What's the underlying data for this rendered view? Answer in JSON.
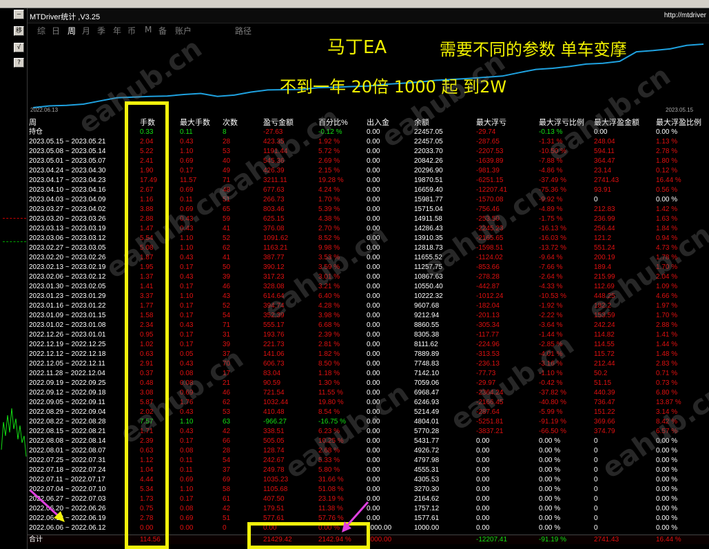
{
  "left_buttons": [
    "—",
    "移",
    "√",
    "?"
  ],
  "window": {
    "title": "MTDriver统计 ,V3.25",
    "url": "http://mtdriver"
  },
  "tabs": [
    {
      "label": "综",
      "active": false
    },
    {
      "label": "日",
      "active": false
    },
    {
      "label": "周",
      "active": true
    },
    {
      "label": "月",
      "active": false
    },
    {
      "label": "季",
      "active": false
    },
    {
      "label": "年",
      "active": false
    },
    {
      "label": "币",
      "active": false
    },
    {
      "label": "M",
      "active": false
    },
    {
      "label": "备",
      "active": false
    },
    {
      "label": "账户",
      "active": false
    },
    {
      "label": "路径",
      "active": false
    }
  ],
  "overlays": {
    "line1": "马丁EA",
    "line2": "需要不同的参数  单车变摩",
    "line3": "不到一年  20倍 1000 起 到2W"
  },
  "chart_data": {
    "type": "line",
    "x_start": "2022.06.13",
    "x_end": "2023.05.15",
    "line_color": "#1fa2e0"
  },
  "watermark": "eahub.cn",
  "headers": [
    "周",
    "手数",
    "最大手数",
    "次数",
    "盈亏金额",
    "百分比%",
    "出入金",
    "余额",
    "最大浮亏",
    "最大浮亏比例",
    "最大浮盈金额",
    "最大浮盈比例"
  ],
  "position_row": [
    "持仓",
    "0.33",
    "0.11",
    "8",
    "-27.63",
    "-0.12 %",
    "0.00",
    "22457.05",
    "-29.74",
    "-0.13 %",
    "0.00",
    "0.00 %"
  ],
  "rows": [
    [
      "2023.05.15 ~ 2023.05.21",
      "2.04",
      "0.43",
      "28",
      "423.35",
      "1.92 %",
      "0.00",
      "22457.05",
      "-287.65",
      "-1.31 %",
      "248.04",
      "1.13 %"
    ],
    [
      "2023.05.08 ~ 2023.05.14",
      "5.22",
      "1.10",
      "53",
      "1191.44",
      "5.72 %",
      "0.00",
      "22033.70",
      "-2207.53",
      "-10.50 %",
      "594.11",
      "2.78 %"
    ],
    [
      "2023.05.01 ~ 2023.05.07",
      "2.41",
      "0.69",
      "40",
      "545.36",
      "2.69 %",
      "0.00",
      "20842.26",
      "-1639.89",
      "-7.88 %",
      "364.47",
      "1.80 %"
    ],
    [
      "2023.04.24 ~ 2023.04.30",
      "1.90",
      "0.17",
      "49",
      "426.39",
      "2.15 %",
      "0.00",
      "20296.90",
      "-981.39",
      "-4.86 %",
      "23.14",
      "0.12 %"
    ],
    [
      "2023.04.17 ~ 2023.04.23",
      "17.49",
      "11.57",
      "71",
      "3211.11",
      "19.28 %",
      "0.00",
      "19870.51",
      "-6251.15",
      "-37.49 %",
      "2741.43",
      "16.44 %"
    ],
    [
      "2023.04.10 ~ 2023.04.16",
      "2.67",
      "0.69",
      "48",
      "677.63",
      "4.24 %",
      "0.00",
      "16659.40",
      "-12207.41",
      "-75.36 %",
      "93.91",
      "0.56 %"
    ],
    [
      "2023.04.03 ~ 2023.04.09",
      "1.16",
      "0.11",
      "51",
      "266.73",
      "1.70 %",
      "0.00",
      "15981.77",
      "-1570.08",
      "-9.92 %",
      "0",
      "0.00 %"
    ],
    [
      "2023.03.27 ~ 2023.04.02",
      "3.88",
      "0.69",
      "65",
      "803.46",
      "5.39 %",
      "0.00",
      "15715.04",
      "-756.46",
      "-4.89 %",
      "212.83",
      "1.42 %"
    ],
    [
      "2023.03.20 ~ 2023.03.26",
      "2.88",
      "0.43",
      "59",
      "625.15",
      "4.38 %",
      "0.00",
      "14911.58",
      "-253.50",
      "-1.75 %",
      "236.99",
      "1.63 %"
    ],
    [
      "2023.03.13 ~ 2023.03.19",
      "1.47",
      "0.43",
      "41",
      "376.08",
      "2.70 %",
      "0.00",
      "14286.43",
      "-2245.23",
      "-16.13 %",
      "256.44",
      "1.84 %"
    ],
    [
      "2023.03.06 ~ 2023.03.12",
      "5.54",
      "1.10",
      "52",
      "1091.62",
      "8.52 %",
      "0.00",
      "13910.35",
      "-2165.65",
      "-16.03 %",
      "121.2",
      "0.94 %"
    ],
    [
      "2023.02.27 ~ 2023.03.05",
      "5.08",
      "1.10",
      "62",
      "1163.21",
      "9.98 %",
      "0.00",
      "12818.73",
      "-1598.51",
      "-13.72 %",
      "551.24",
      "4.73 %"
    ],
    [
      "2023.02.20 ~ 2023.02.26",
      "1.87",
      "0.43",
      "41",
      "387.77",
      "3.53 %",
      "0.00",
      "11655.52",
      "-1124.02",
      "-9.64 %",
      "200.19",
      "1.78 %"
    ],
    [
      "2023.02.13 ~ 2023.02.19",
      "1.95",
      "0.17",
      "50",
      "390.12",
      "3.59 %",
      "0.00",
      "11257.75",
      "-853.66",
      "-7.66 %",
      "189.4",
      "1.70 %"
    ],
    [
      "2023.02.06 ~ 2023.02.12",
      "1.37",
      "0.43",
      "39",
      "317.23",
      "3.01 %",
      "0.00",
      "10867.63",
      "-278.28",
      "-2.64 %",
      "215.99",
      "2.04 %"
    ],
    [
      "2023.01.30 ~ 2023.02.05",
      "1.41",
      "0.17",
      "46",
      "328.08",
      "3.21 %",
      "0.00",
      "10550.40",
      "-442.87",
      "-4.33 %",
      "112.69",
      "1.09 %"
    ],
    [
      "2023.01.23 ~ 2023.01.29",
      "3.37",
      "1.10",
      "43",
      "614.64",
      "6.40 %",
      "0.00",
      "10222.32",
      "-1012.24",
      "-10.53 %",
      "448.25",
      "4.66 %"
    ],
    [
      "2023.01.16 ~ 2023.01.22",
      "1.77",
      "0.17",
      "52",
      "394.74",
      "4.28 %",
      "0.00",
      "9607.68",
      "-182.04",
      "-1.92 %",
      "182.2",
      "1.97 %"
    ],
    [
      "2023.01.09 ~ 2023.01.15",
      "1.58",
      "0.17",
      "54",
      "352.39",
      "3.98 %",
      "0.00",
      "9212.94",
      "-201.13",
      "-2.22 %",
      "153.59",
      "1.70 %"
    ],
    [
      "2023.01.02 ~ 2023.01.08",
      "2.34",
      "0.43",
      "71",
      "555.17",
      "6.68 %",
      "0.00",
      "8860.55",
      "-305.34",
      "-3.64 %",
      "242.24",
      "2.88 %"
    ],
    [
      "2022.12.26 ~ 2023.01.01",
      "0.95",
      "0.17",
      "31",
      "193.76",
      "2.39 %",
      "0.00",
      "8305.38",
      "-117.77",
      "-1.44 %",
      "114.82",
      "1.41 %"
    ],
    [
      "2022.12.19 ~ 2022.12.25",
      "1.02",
      "0.17",
      "39",
      "221.73",
      "2.81 %",
      "0.00",
      "8111.62",
      "-224.96",
      "-2.85 %",
      "114.55",
      "1.44 %"
    ],
    [
      "2022.12.12 ~ 2022.12.18",
      "0.63",
      "0.05",
      "37",
      "141.06",
      "1.82 %",
      "0.00",
      "7889.89",
      "-313.53",
      "-4.01 %",
      "115.72",
      "1.48 %"
    ],
    [
      "2022.12.05 ~ 2022.12.11",
      "2.91",
      "0.43",
      "70",
      "606.73",
      "8.50 %",
      "0.00",
      "7748.83",
      "-236.13",
      "-3.16 %",
      "212.44",
      "2.83 %"
    ],
    [
      "2022.11.28 ~ 2022.12.04",
      "0.37",
      "0.08",
      "17",
      "83.04",
      "1.18 %",
      "0.00",
      "7142.10",
      "-77.73",
      "-1.10 %",
      "50.2",
      "0.71 %"
    ],
    [
      "2022.09.19 ~ 2022.09.25",
      "0.48",
      "0.08",
      "21",
      "90.59",
      "1.30 %",
      "0.00",
      "7059.06",
      "-29.97",
      "-0.42 %",
      "51.15",
      "0.73 %"
    ],
    [
      "2022.09.12 ~ 2022.09.18",
      "3.08",
      "0.69",
      "46",
      "721.54",
      "11.55 %",
      "0.00",
      "6968.47",
      "-2364.24",
      "-37.82 %",
      "440.39",
      "6.80 %"
    ],
    [
      "2022.09.05 ~ 2022.09.11",
      "5.87",
      "1.76",
      "62",
      "1032.44",
      "19.80 %",
      "0.00",
      "6246.93",
      "-2166.45",
      "-40.80 %",
      "736.47",
      "13.87 %"
    ],
    [
      "2022.08.29 ~ 2022.09.04",
      "2.02",
      "0.43",
      "53",
      "410.48",
      "8.54 %",
      "0.00",
      "5214.49",
      "-287.64",
      "-5.99 %",
      "151.22",
      "3.14 %"
    ],
    [
      "2022.08.22 ~ 2022.08.28",
      "7.57",
      "1.10",
      "63",
      "-966.27",
      "-16.75 %",
      "0.00",
      "4804.01",
      "-5251.81",
      "-91.19 %",
      "369.66",
      "8.42 %"
    ],
    [
      "2022.08.15 ~ 2022.08.21",
      "1.71",
      "0.43",
      "42",
      "338.51",
      "6.23 %",
      "0.00",
      "5770.28",
      "-3837.21",
      "-66.50 %",
      "374.79",
      "6.57 %"
    ],
    [
      "2022.08.08 ~ 2022.08.14",
      "2.39",
      "0.17",
      "66",
      "505.05",
      "10.25 %",
      "0.00",
      "5431.77",
      "0.00",
      "0.00 %",
      "0",
      "0.00 %"
    ],
    [
      "2022.08.01 ~ 2022.08.07",
      "0.63",
      "0.08",
      "28",
      "128.74",
      "2.68 %",
      "0.00",
      "4926.72",
      "0.00",
      "0.00 %",
      "0",
      "0.00 %"
    ],
    [
      "2022.07.25 ~ 2022.07.31",
      "1.12",
      "0.11",
      "54",
      "242.67",
      "5.33 %",
      "0.00",
      "4797.98",
      "0.00",
      "0.00 %",
      "0",
      "0.00 %"
    ],
    [
      "2022.07.18 ~ 2022.07.24",
      "1.04",
      "0.11",
      "37",
      "249.78",
      "5.80 %",
      "0.00",
      "4555.31",
      "0.00",
      "0.00 %",
      "0",
      "0.00 %"
    ],
    [
      "2022.07.11 ~ 2022.07.17",
      "4.44",
      "0.69",
      "69",
      "1035.23",
      "31.66 %",
      "0.00",
      "4305.53",
      "0.00",
      "0.00 %",
      "0",
      "0.00 %"
    ],
    [
      "2022.07.04 ~ 2022.07.10",
      "5.34",
      "1.10",
      "58",
      "1105.68",
      "51.08 %",
      "0.00",
      "3270.30",
      "0.00",
      "0.00 %",
      "0",
      "0.00 %"
    ],
    [
      "2022.06.27 ~ 2022.07.03",
      "1.73",
      "0.17",
      "61",
      "407.50",
      "23.19 %",
      "0.00",
      "2164.62",
      "0.00",
      "0.00 %",
      "0",
      "0.00 %"
    ],
    [
      "2022.06.20 ~ 2022.06.26",
      "0.75",
      "0.08",
      "42",
      "179.51",
      "11.38 %",
      "0.00",
      "1757.12",
      "0.00",
      "0.00 %",
      "0",
      "0.00 %"
    ],
    [
      "2022.06.13 ~ 2022.06.19",
      "2.78",
      "0.69",
      "51",
      "577.61",
      "57.76 %",
      "0.00",
      "1577.61",
      "0.00",
      "0.00 %",
      "0",
      "0.00 %"
    ],
    [
      "2022.06.06 ~ 2022.06.12",
      "0.00",
      "0.00",
      "0",
      "0.00",
      "0.00 %",
      "1000.00",
      "1000.00",
      "0.00",
      "0.00 %",
      "0",
      "0.00 %"
    ]
  ],
  "total_row": [
    "合计",
    "114.56",
    "",
    "",
    "21429.42",
    "2142.94 %",
    "1000.00",
    "",
    "-12207.41",
    "-91.19 %",
    "2741.43",
    "16.44 %"
  ]
}
